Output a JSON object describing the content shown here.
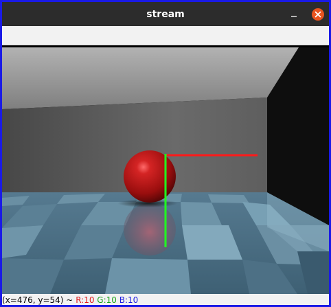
{
  "window": {
    "title": "stream",
    "border_color": "#1a1ae6"
  },
  "titlebar": {
    "background": "#2c2c2c",
    "minimize_icon": "minimize-icon",
    "close_icon": "close-icon",
    "close_color": "#e95420"
  },
  "viewport": {
    "scene": "rendered 3D room with red sphere on reflective checkered floor",
    "axis_x_color": "#ff0000",
    "axis_y_color": "#00ff00"
  },
  "status": {
    "coords": "(x=476, y=54) ~",
    "r": "R:10",
    "g": "G:10",
    "b": "B:10"
  }
}
